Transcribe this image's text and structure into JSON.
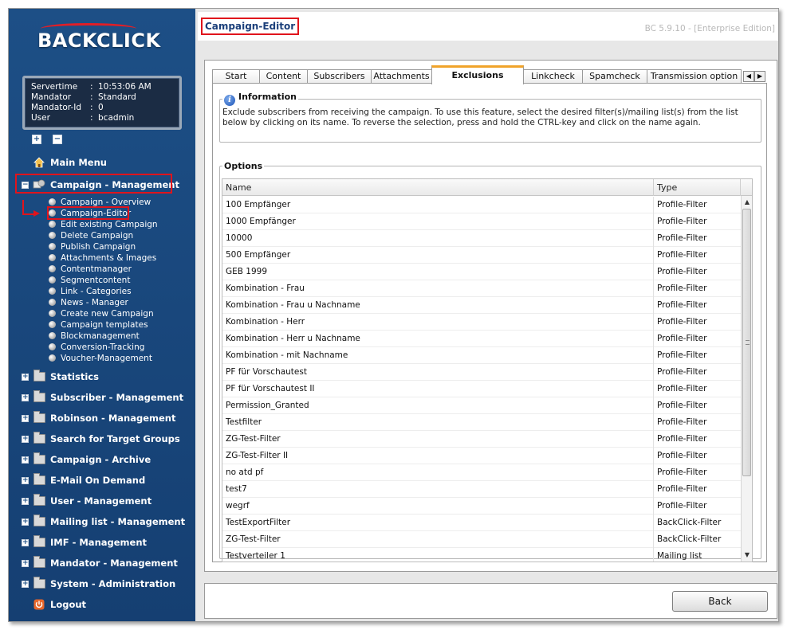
{
  "app": {
    "logo_text": "BACKCLICK",
    "version": "BC 5.9.10 - [Enterprise Edition]"
  },
  "info": [
    {
      "key": "Servertime",
      "value": "10:53:06 AM"
    },
    {
      "key": "Mandator",
      "value": "Standard"
    },
    {
      "key": "Mandator-Id",
      "value": "0"
    },
    {
      "key": "User",
      "value": "bcadmin"
    }
  ],
  "tree_controls": {
    "expand": "+",
    "collapse": "−"
  },
  "nav": {
    "main_menu": "Main Menu",
    "campaign_management": "Campaign - Management",
    "campaign_subitems": [
      "Campaign - Overview",
      "Campaign-Editor",
      "Edit existing Campaign",
      "Delete Campaign",
      "Publish Campaign",
      "Attachments & Images",
      "Contentmanager",
      "Segmentcontent",
      "Link - Categories",
      "News - Manager",
      "Create new Campaign",
      "Campaign templates",
      "Blockmanagement",
      "Conversion-Tracking",
      "Voucher-Management"
    ],
    "sections": [
      "Statistics",
      "Subscriber - Management",
      "Robinson - Management",
      "Search for Target Groups",
      "Campaign - Archive",
      "E-Mail On Demand",
      "User - Management",
      "Mailing list - Management",
      "IMF - Management",
      "Mandator - Management",
      "System - Administration"
    ],
    "logout": "Logout"
  },
  "page": {
    "title": "Campaign-Editor"
  },
  "tabs": [
    "Start",
    "Content",
    "Subscribers",
    "Attachments",
    "Exclusions",
    "Linkcheck",
    "Spamcheck",
    "Transmission option"
  ],
  "active_tab": "Exclusions",
  "information": {
    "title": "Information",
    "text": "Exclude subscribers from receiving the campaign. To use this feature, select the desired filter(s)/mailing list(s) from the list below by clicking on its name. To reverse the selection, press and hold the CTRL-key and click on the name again."
  },
  "options": {
    "title": "Options",
    "columns": [
      "Name",
      "Type"
    ],
    "rows": [
      {
        "name": "100 Empfänger",
        "type": "Profile-Filter"
      },
      {
        "name": "1000 Empfänger",
        "type": "Profile-Filter"
      },
      {
        "name": "10000",
        "type": "Profile-Filter"
      },
      {
        "name": "500 Empfänger",
        "type": "Profile-Filter"
      },
      {
        "name": "GEB 1999",
        "type": "Profile-Filter"
      },
      {
        "name": "Kombination - Frau",
        "type": "Profile-Filter"
      },
      {
        "name": "Kombination - Frau u Nachname",
        "type": "Profile-Filter"
      },
      {
        "name": "Kombination - Herr",
        "type": "Profile-Filter"
      },
      {
        "name": "Kombination - Herr u Nachname",
        "type": "Profile-Filter"
      },
      {
        "name": "Kombination - mit Nachname",
        "type": "Profile-Filter"
      },
      {
        "name": "PF für Vorschautest",
        "type": "Profile-Filter"
      },
      {
        "name": "PF für Vorschautest II",
        "type": "Profile-Filter"
      },
      {
        "name": "Permission_Granted",
        "type": "Profile-Filter"
      },
      {
        "name": "Testfilter",
        "type": "Profile-Filter"
      },
      {
        "name": "ZG-Test-Filter",
        "type": "Profile-Filter"
      },
      {
        "name": "ZG-Test-Filter II",
        "type": "Profile-Filter"
      },
      {
        "name": "no atd pf",
        "type": "Profile-Filter"
      },
      {
        "name": "test7",
        "type": "Profile-Filter"
      },
      {
        "name": "wegrf",
        "type": "Profile-Filter"
      },
      {
        "name": "TestExportFilter",
        "type": "BackClick-Filter"
      },
      {
        "name": "ZG-Test-Filter",
        "type": "BackClick-Filter"
      },
      {
        "name": "Testverteiler 1",
        "type": "Mailing list"
      }
    ]
  },
  "buttons": {
    "back": "Back"
  },
  "colors": {
    "sidebar": "#1d4f86",
    "highlight": "#e0141c",
    "active_tab": "#f0a32a"
  }
}
